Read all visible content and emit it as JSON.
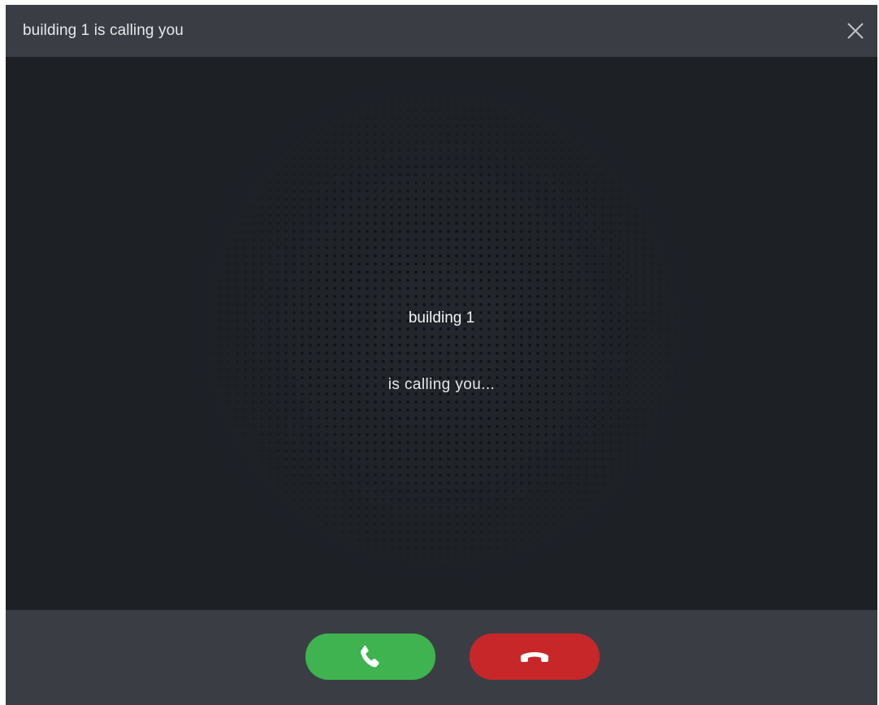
{
  "window": {
    "title": "building 1 is calling you",
    "close_icon": "close-icon"
  },
  "call": {
    "caller": "building 1",
    "status": "is calling you..."
  },
  "actions": {
    "accept_icon": "phone-accept-icon",
    "decline_icon": "phone-hangup-icon"
  },
  "colors": {
    "titlebar": "#3a3e44",
    "background": "#1d2025",
    "accept": "#3fb34f",
    "decline": "#c8272a"
  }
}
